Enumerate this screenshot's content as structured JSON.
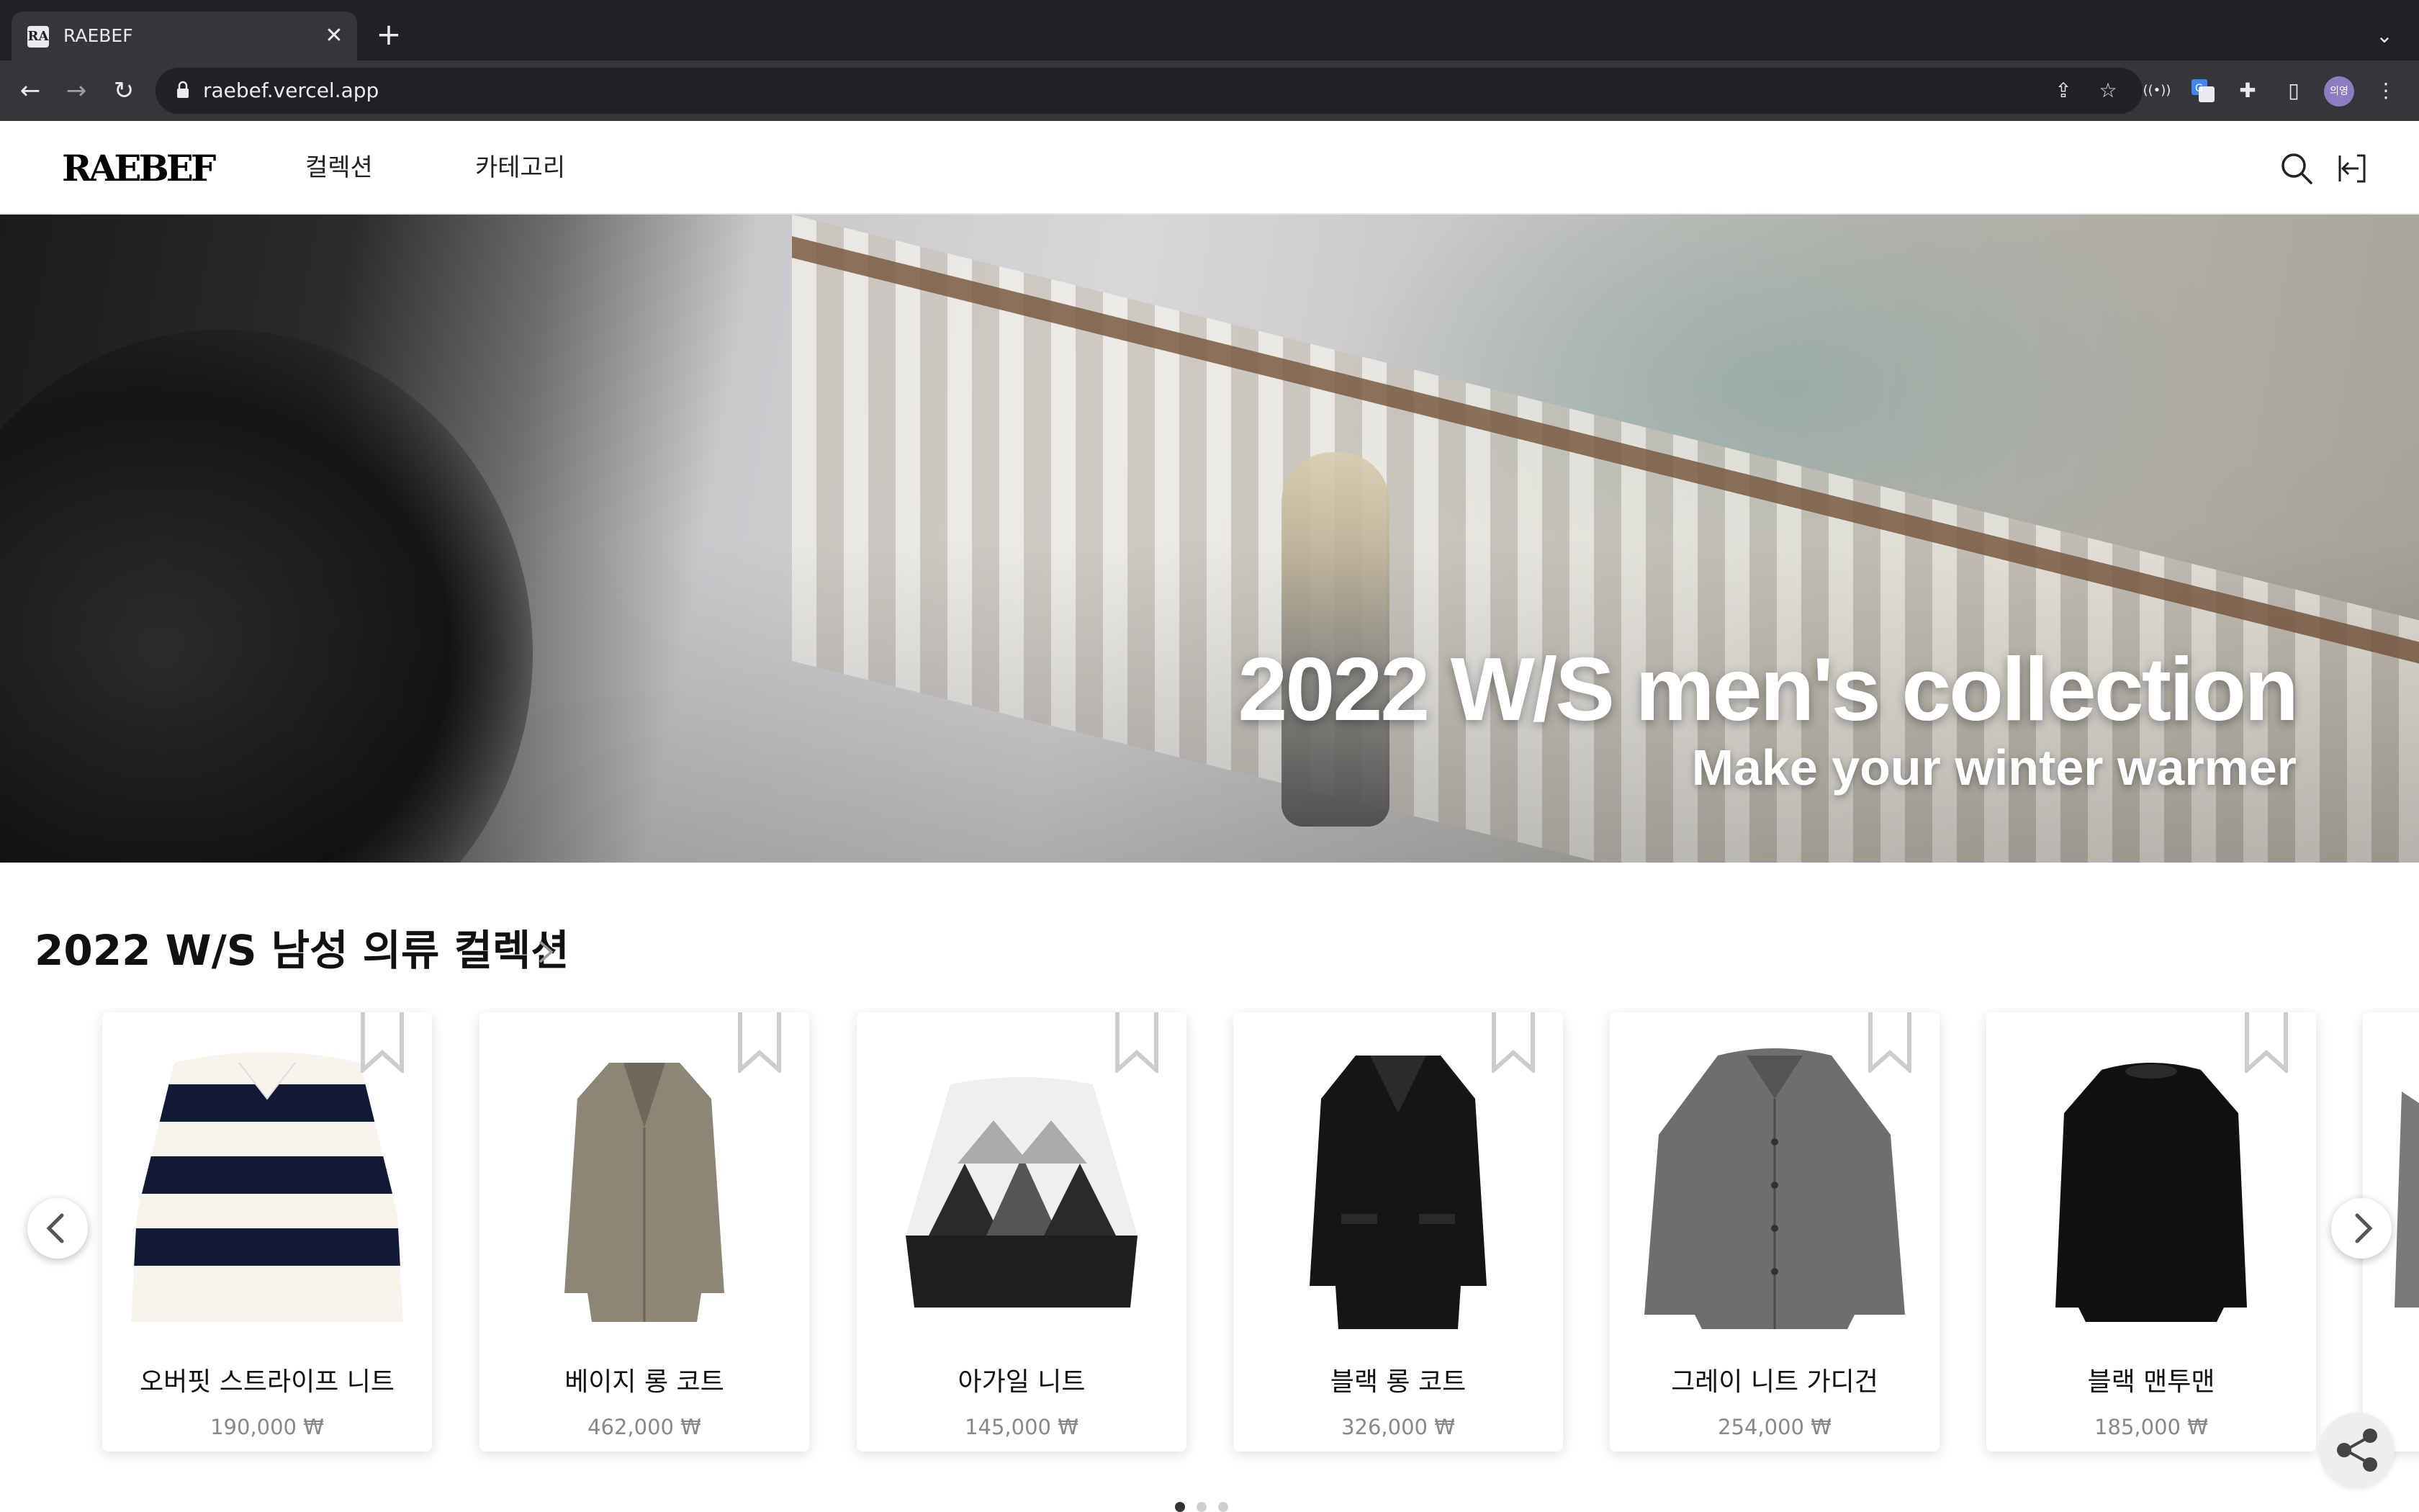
{
  "browser": {
    "tab_title": "RAEBEF",
    "tab_favicon_text": "RA",
    "url": "raebef.vercel.app",
    "profile_initials": "의영",
    "icons": [
      "back-icon",
      "forward-icon",
      "reload-icon",
      "lock-icon",
      "share-page-icon",
      "star-icon",
      "cast-icon",
      "translate-icon",
      "extensions-icon",
      "side-panel-icon",
      "menu-icon"
    ]
  },
  "header": {
    "logo": "RAEBEF",
    "nav": [
      {
        "label": "컬렉션"
      },
      {
        "label": "카테고리"
      }
    ],
    "icons": [
      "search-icon",
      "logout-icon"
    ]
  },
  "hero": {
    "title": "2022 W/S men's collection",
    "subtitle": "Make your winter warmer"
  },
  "collection": {
    "title": "2022 W/S 남성 의류 컬렉션",
    "products": [
      {
        "name": "오버핏 스트라이프 니트",
        "price": "190,000 ₩",
        "image": "striped-knit"
      },
      {
        "name": "베이지 롱 코트",
        "price": "462,000 ₩",
        "image": "beige-coat"
      },
      {
        "name": "아가일 니트",
        "price": "145,000 ₩",
        "image": "argyle-knit"
      },
      {
        "name": "블랙 롱 코트",
        "price": "326,000 ₩",
        "image": "black-coat"
      },
      {
        "name": "그레이 니트 가디건",
        "price": "254,000 ₩",
        "image": "gray-cardigan"
      },
      {
        "name": "블랙 맨투맨",
        "price": "185,000 ₩",
        "image": "black-sweatshirt"
      }
    ],
    "pagination": {
      "pages": 3,
      "current": 1
    }
  },
  "colors": {
    "chrome_bg": "#202124",
    "chrome_toolbar": "#35363a",
    "text_primary": "#111111",
    "price_gray": "#888888"
  }
}
